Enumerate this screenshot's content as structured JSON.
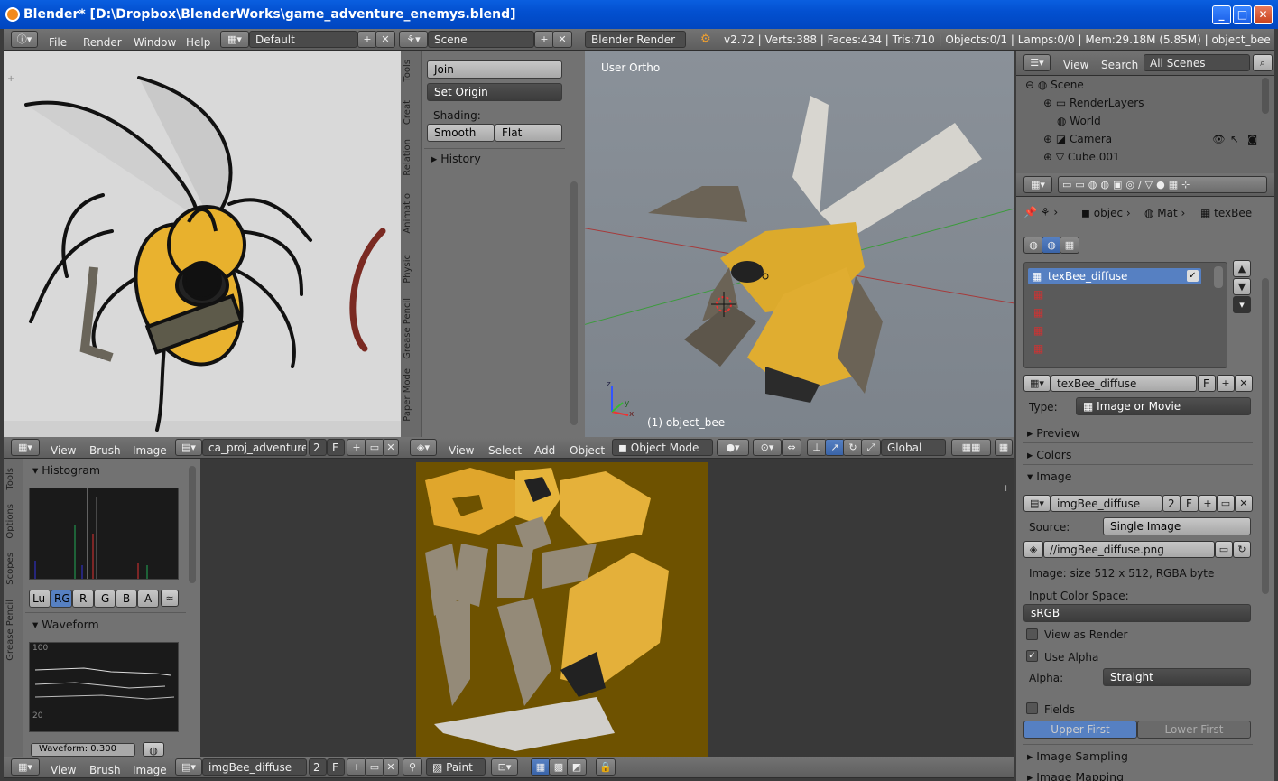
{
  "window": {
    "title": "Blender* [D:\\Dropbox\\BlenderWorks\\game_adventure_enemys.blend]",
    "min": "_",
    "max": "□",
    "close": "✕"
  },
  "topbar": {
    "menus": [
      "File",
      "Render",
      "Window",
      "Help"
    ],
    "layout": "Default",
    "scene": "Scene",
    "engine": "Blender Render",
    "stats": "v2.72 | Verts:388 | Faces:434 | Tris:710 | Objects:0/1 | Lamps:0/0 | Mem:29.18M (5.85M) | object_bee"
  },
  "image_editor_top": {
    "menus": [
      "View",
      "Brush",
      "Image"
    ],
    "image_name": "ca_proj_adventure_...",
    "users": "2",
    "fake": "F"
  },
  "toolshelf": {
    "tabs": [
      "Tools",
      "Creat",
      "Relation",
      "Animatio",
      "Physic",
      "Grease Pencil",
      "Paper Mode"
    ],
    "join": "Join",
    "set_origin": "Set Origin",
    "shading_label": "Shading:",
    "smooth": "Smooth",
    "flat": "Flat",
    "history": "History"
  },
  "viewport": {
    "view_label": "User Ortho",
    "object_label": "(1) object_bee",
    "menus": [
      "View",
      "Select",
      "Add",
      "Object"
    ],
    "mode": "Object Mode",
    "orientation": "Global",
    "axis_x": "x",
    "axis_y": "y",
    "axis_z": "z"
  },
  "outliner": {
    "menus": [
      "View",
      "Search"
    ],
    "filter": "All Scenes",
    "items": [
      "Scene",
      "RenderLayers",
      "World",
      "Camera",
      "Cube.001"
    ]
  },
  "properties": {
    "breadcrumb": [
      "objec",
      "Mat",
      "texBee"
    ],
    "slot_name": "texBee_diffuse",
    "texture_name": "texBee_diffuse",
    "tex_fake": "F",
    "type_label": "Type:",
    "type_value": "Image or Movie",
    "sections": {
      "preview": "Preview",
      "colors": "Colors",
      "image": "Image",
      "image_sampling": "Image Sampling",
      "image_mapping": "Image Mapping"
    },
    "image_name": "imgBee_diffuse",
    "image_users": "2",
    "image_fake": "F",
    "source_label": "Source:",
    "source_value": "Single Image",
    "filepath": "//imgBee_diffuse.png",
    "image_info": "Image: size 512 x 512, RGBA byte",
    "color_space_label": "Input Color Space:",
    "color_space": "sRGB",
    "view_as_render": "View as Render",
    "use_alpha": "Use Alpha",
    "alpha_label": "Alpha:",
    "alpha_value": "Straight",
    "fields": "Fields",
    "upper_first": "Upper First",
    "lower_first": "Lower First"
  },
  "scopes": {
    "tabs": [
      "Tools",
      "Options",
      "Scopes",
      "Grease Pencil"
    ],
    "histogram": "Histogram",
    "channels": [
      "Lu",
      "RG",
      "R",
      "G",
      "B",
      "A"
    ],
    "waveform": "Waveform",
    "wf_top": "100",
    "wf_bottom": "20",
    "waveform_opacity": "Waveform: 0.300"
  },
  "image_editor_bottom": {
    "menus": [
      "View",
      "Brush",
      "Image"
    ],
    "image_name": "imgBee_diffuse",
    "users": "2",
    "fake": "F",
    "mode": "Paint"
  }
}
